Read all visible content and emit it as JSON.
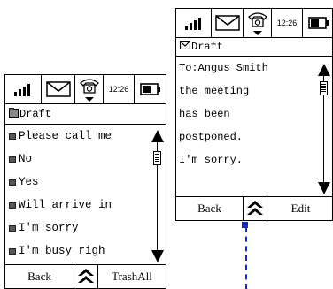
{
  "left_screen": {
    "status": {
      "time": "12:26"
    },
    "title": "Draft",
    "items": [
      {
        "label": "Please call me"
      },
      {
        "label": "No"
      },
      {
        "label": "Yes"
      },
      {
        "label": "Will arrive in"
      },
      {
        "label": "I'm sorry"
      },
      {
        "label": "I'm busy righ"
      }
    ],
    "softkeys": {
      "left": "Back",
      "right": "TrashAll"
    }
  },
  "right_screen": {
    "status": {
      "time": "12:26"
    },
    "title": "Draft",
    "message_lines": [
      "To:Angus Smith",
      "the meeting",
      "has been",
      "postponed.",
      "I'm sorry."
    ],
    "softkeys": {
      "left": "Back",
      "right": "Edit"
    }
  },
  "colors": {
    "pointer": "#1a2db8"
  }
}
